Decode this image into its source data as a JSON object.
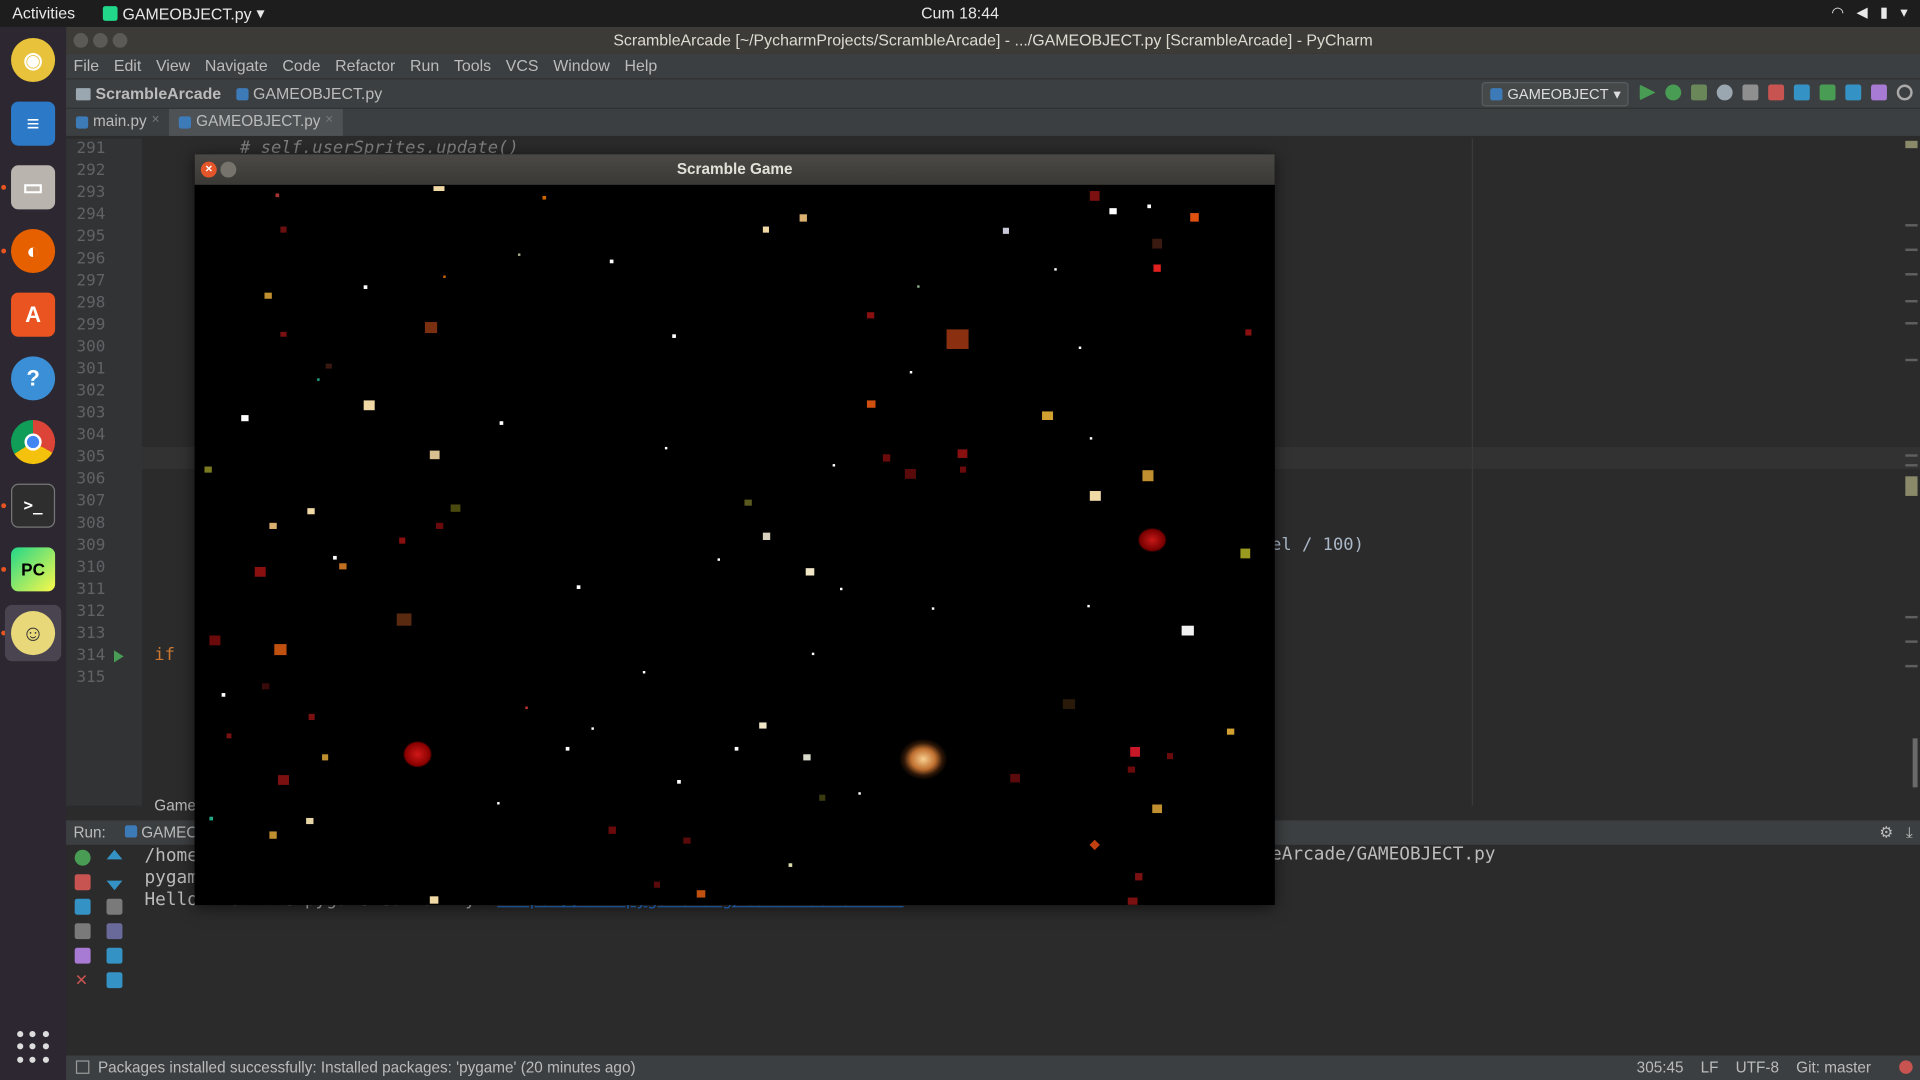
{
  "topbar": {
    "activities": "Activities",
    "app": "GAMEOBJECT.py",
    "clock": "Cum 18:44"
  },
  "ide": {
    "title": "ScrambleArcade [~/PycharmProjects/ScrambleArcade] - .../GAMEOBJECT.py [ScrambleArcade] - PyCharm",
    "menu": [
      "File",
      "Edit",
      "View",
      "Navigate",
      "Code",
      "Refactor",
      "Run",
      "Tools",
      "VCS",
      "Window",
      "Help"
    ],
    "breadcrumb": {
      "project": "ScrambleArcade",
      "file": "GAMEOBJECT.py"
    },
    "run_config": "GAMEOBJECT",
    "tabs": [
      "main.py",
      "GAMEOBJECT.py"
    ],
    "line_numbers": [
      "291",
      "292",
      "293",
      "294",
      "295",
      "296",
      "297",
      "298",
      "299",
      "300",
      "301",
      "302",
      "303",
      "304",
      "305",
      "306",
      "307",
      "308",
      "309",
      "310",
      "311",
      "312",
      "313",
      "314",
      "315"
    ],
    "code_comment": "# self.userSprites.update()",
    "code_if": "if",
    "code_right": "el / 100)",
    "game_tab": "Game",
    "run_label": "Run:",
    "run_tab": "GAMEO",
    "console": {
      "line1": "/home",
      "line1_right": "eArcade/GAMEOBJECT.py",
      "line2": "pygam",
      "line3_prefix": "Hello from the pygame community.",
      "line3_link": "https://www.pygame.org/contribute.html"
    },
    "status": {
      "message": "Packages installed successfully: Installed packages: 'pygame' (20 minutes ago)",
      "position": "305:45",
      "line_sep": "LF",
      "encoding": "UTF-8",
      "git": "Git: master"
    }
  },
  "game": {
    "title": "Scramble Game",
    "close_glyph": "×"
  },
  "colors": {
    "accent": "#e95420",
    "editor_bg": "#2b2b2b",
    "link": "#287bde"
  }
}
